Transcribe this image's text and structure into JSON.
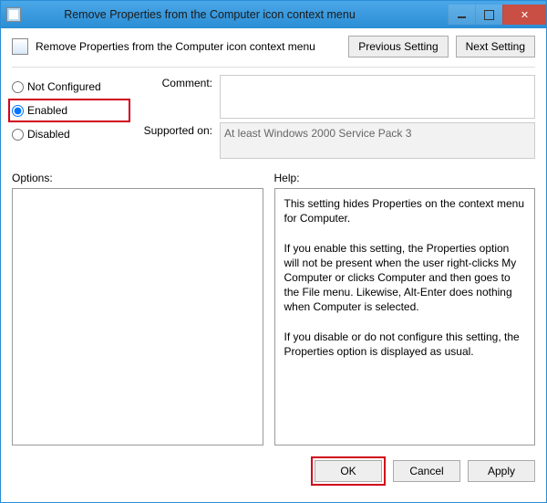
{
  "window": {
    "title": "Remove Properties from the Computer icon context menu"
  },
  "header": {
    "policy_title": "Remove Properties from the Computer icon context menu",
    "prev_label": "Previous Setting",
    "next_label": "Next Setting"
  },
  "config": {
    "not_configured_label": "Not Configured",
    "enabled_label": "Enabled",
    "disabled_label": "Disabled",
    "selected": "enabled",
    "comment_label": "Comment:",
    "comment_value": "",
    "supported_label": "Supported on:",
    "supported_value": "At least Windows 2000 Service Pack 3"
  },
  "panels": {
    "options_label": "Options:",
    "help_label": "Help:",
    "help_text": "This setting hides Properties on the context menu for Computer.\n\nIf you enable this setting, the Properties option will not be present when the user right-clicks My Computer or clicks Computer and then goes to the File menu.  Likewise, Alt-Enter does nothing when Computer is selected.\n\nIf you disable or do not configure this setting, the Properties option is displayed as usual."
  },
  "footer": {
    "ok_label": "OK",
    "cancel_label": "Cancel",
    "apply_label": "Apply"
  }
}
